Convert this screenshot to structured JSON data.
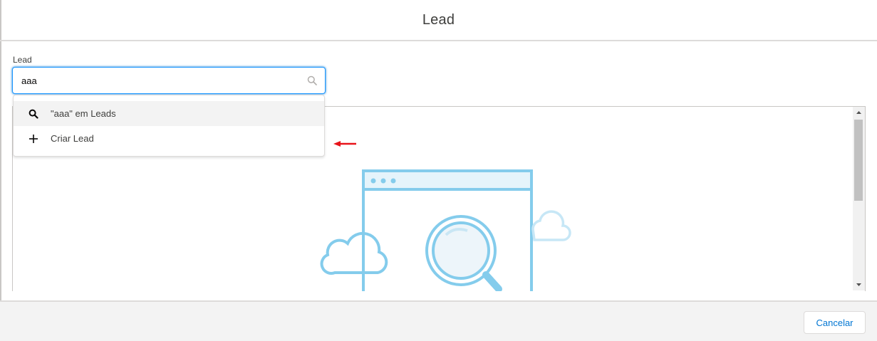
{
  "modal": {
    "title": "Lead"
  },
  "lookup": {
    "label": "Lead",
    "value": "aaa",
    "icon": "search-icon"
  },
  "dropdown": {
    "items": [
      {
        "label": "\"aaa\" em Leads",
        "icon": "search-icon",
        "highlighted": true
      },
      {
        "label": "Criar Lead",
        "icon": "plus-icon",
        "highlighted": false
      }
    ]
  },
  "annotation": {
    "arrow_color": "#e8141a"
  },
  "illustration": {
    "icon": "browser-magnifier-clouds-illustration",
    "color": "#84ccec"
  },
  "footer": {
    "cancel_label": "Cancelar"
  },
  "colors": {
    "accent": "#0176d3",
    "focus_border": "#1b96ff"
  }
}
